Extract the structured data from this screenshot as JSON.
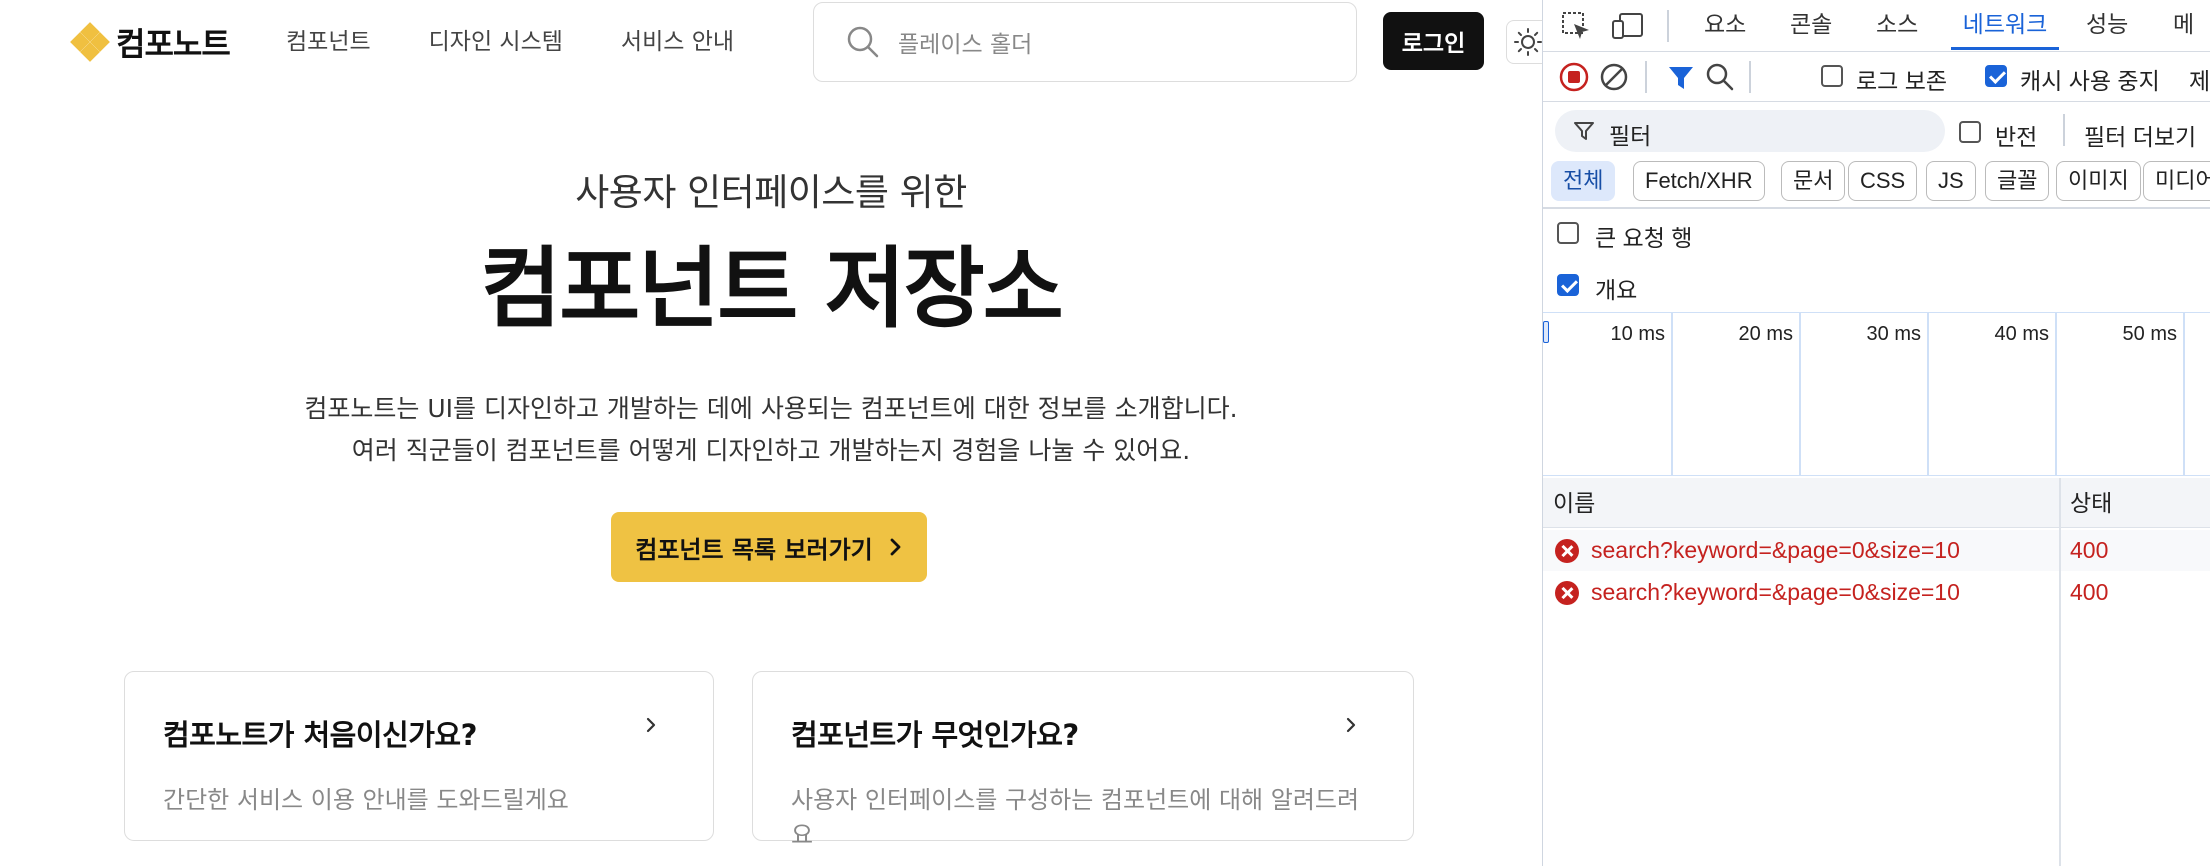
{
  "site": {
    "logo_text": "컴포노트",
    "nav": [
      "컴포넌트",
      "디자인 시스템",
      "서비스 안내"
    ],
    "search": {
      "placeholder": "플레이스 홀더"
    },
    "login_label": "로그인",
    "hero": {
      "subtitle": "사용자 인터페이스를 위한",
      "title": "컴포넌트 저장소",
      "desc_line1": "컴포노트는 UI를 디자인하고 개발하는 데에 사용되는 컴포넌트에 대한 정보를 소개합니다.",
      "desc_line2": "여러 직군들이 컴포넌트를 어떻게 디자인하고 개발하는지 경험을 나눌 수 있어요.",
      "cta_label": "컴포넌트 목록 보러가기"
    },
    "cards": [
      {
        "title": "컴포노트가 처음이신가요?",
        "desc": "간단한 서비스 이용 안내를 도와드릴게요"
      },
      {
        "title": "컴포넌트가 무엇인가요?",
        "desc": "사용자 인터페이스를 구성하는 컴포넌트에 대해 알려드려요"
      }
    ],
    "colors": {
      "accent": "#efc243",
      "logo": "#f0c040"
    }
  },
  "devtools": {
    "tabs": [
      "요소",
      "콘솔",
      "소스",
      "네트워크",
      "성능",
      "메"
    ],
    "active_tab": "네트워크",
    "toolbar": {
      "preserve_log": "로그 보존",
      "disable_cache": "캐시 사용 중지",
      "overflow": "제"
    },
    "filter": {
      "placeholder": "필터",
      "invert": "반전",
      "more_filters": "필터 더보기"
    },
    "type_chips": [
      "전체",
      "Fetch/XHR",
      "문서",
      "CSS",
      "JS",
      "글꼴",
      "이미지",
      "미디어"
    ],
    "options": {
      "big_rows": "큰 요청 행",
      "overview": "개요"
    },
    "timeline_labels": [
      "10 ms",
      "20 ms",
      "30 ms",
      "40 ms",
      "50 ms"
    ],
    "table": {
      "col_name": "이름",
      "col_status": "상태",
      "rows": [
        {
          "name": "search?keyword=&page=0&size=10",
          "status": "400"
        },
        {
          "name": "search?keyword=&page=0&size=10",
          "status": "400"
        }
      ]
    },
    "colors": {
      "active": "#1a63d8",
      "error": "#c5221f"
    }
  }
}
